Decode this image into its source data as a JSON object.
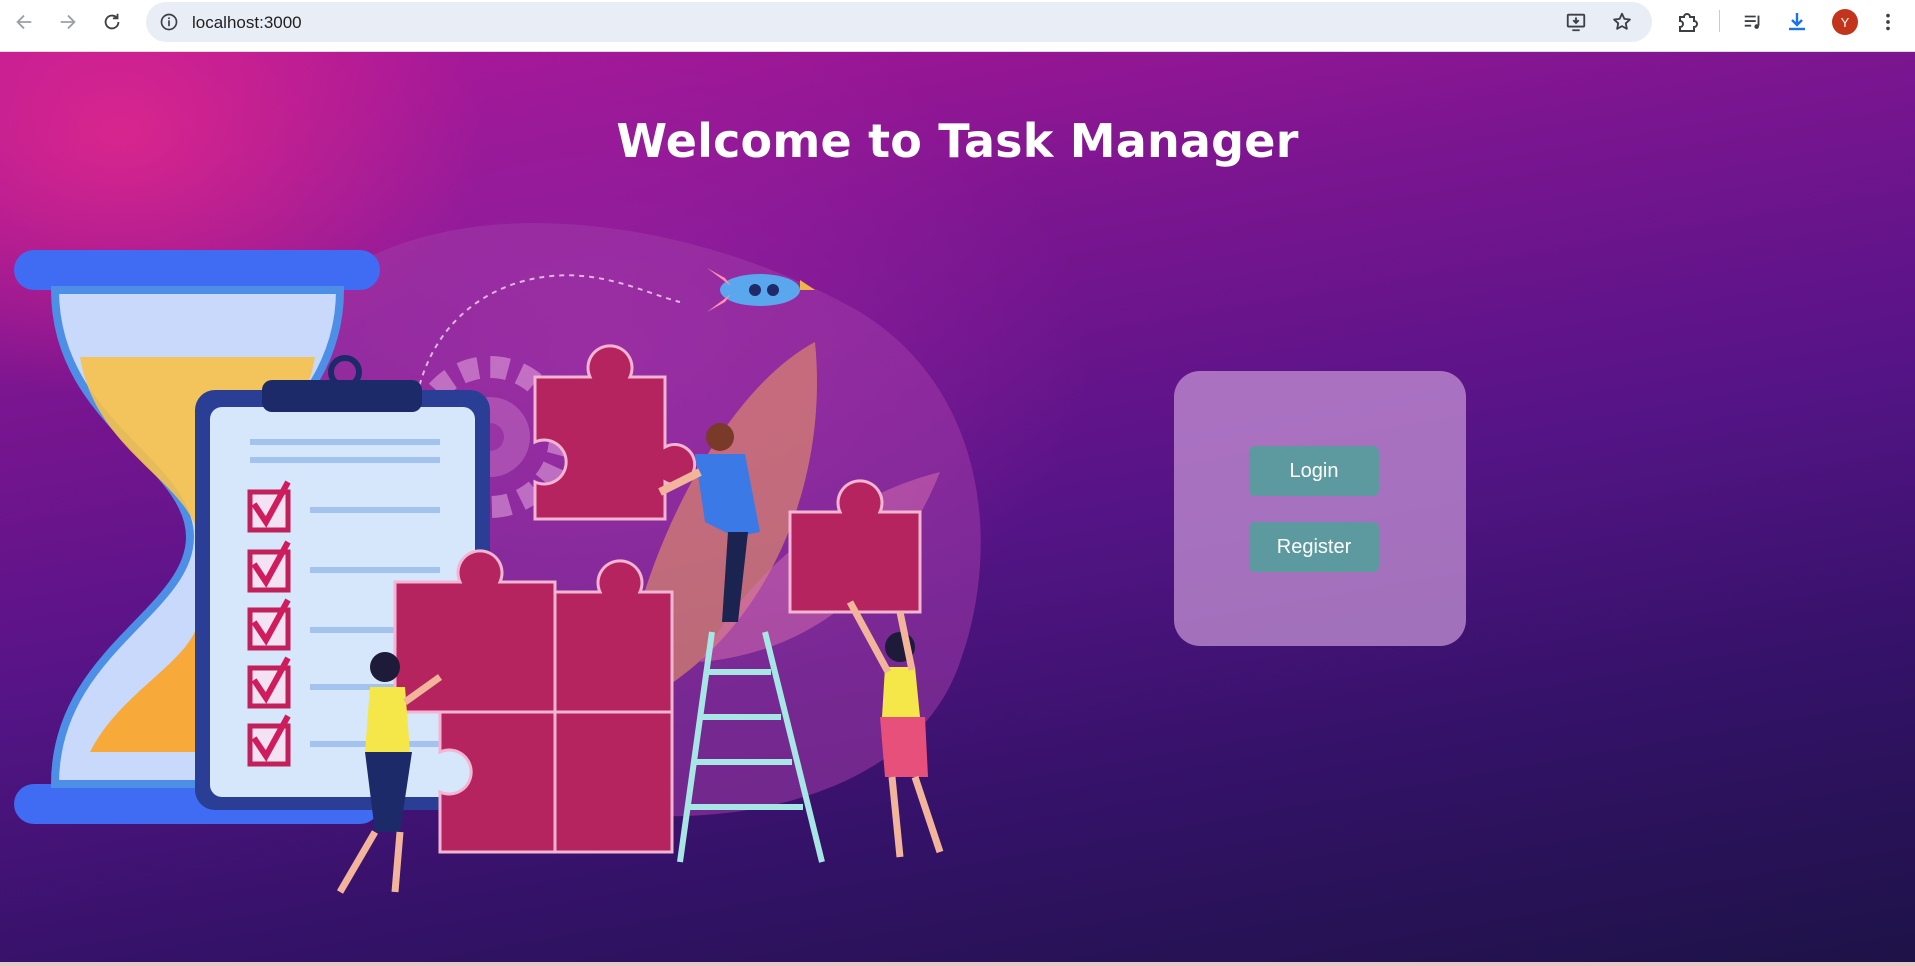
{
  "browser": {
    "url": "localhost:3000",
    "avatar_letter": "Y",
    "icons": [
      "back-icon",
      "forward-icon",
      "reload-icon",
      "site-info-icon",
      "install-app-icon",
      "bookmark-star-icon",
      "extensions-icon",
      "media-controls-icon",
      "downloads-icon",
      "menu-kebab-icon"
    ]
  },
  "page": {
    "title": "Welcome to Task Manager"
  },
  "auth": {
    "login_label": "Login",
    "register_label": "Register"
  },
  "colors": {
    "button": "#5c9aa0",
    "card": "#c896d7",
    "bg_top": "#b2189a",
    "bg_bottom": "#1d1247",
    "avatar": "#c2341b"
  }
}
